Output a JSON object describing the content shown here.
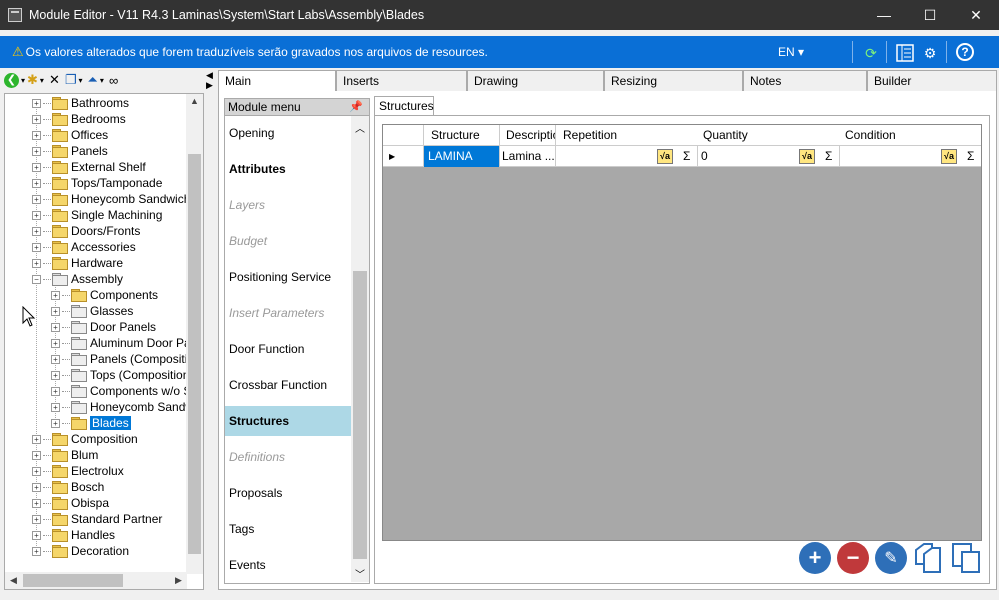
{
  "window": {
    "title": "Module Editor - V11 R4.3 Laminas\\System\\Start Labs\\Assembly\\Blades",
    "minimize": "—",
    "maximize": "☐",
    "close": "✕"
  },
  "notification": {
    "icon": "warning-icon",
    "message": "Os valores alterados que forem traduzíveis serão gravados nos arquivos de resources.",
    "language": "EN ▾",
    "refresh": "⟳",
    "help": "?"
  },
  "tree": {
    "items": [
      {
        "label": "Bathrooms"
      },
      {
        "label": "Bedrooms"
      },
      {
        "label": "Offices"
      },
      {
        "label": "Panels"
      },
      {
        "label": "External Shelf"
      },
      {
        "label": "Tops/Tamponade"
      },
      {
        "label": "Honeycomb Sandwich"
      },
      {
        "label": "Single Machining"
      },
      {
        "label": "Doors/Fronts"
      },
      {
        "label": "Accessories"
      },
      {
        "label": "Hardware"
      },
      {
        "label": "Assembly"
      },
      {
        "label": "Components"
      },
      {
        "label": "Glasses"
      },
      {
        "label": "Door Panels"
      },
      {
        "label": "Aluminum Door Pane"
      },
      {
        "label": "Panels (Composition"
      },
      {
        "label": "Tops (Composition)"
      },
      {
        "label": "Components w/o Str"
      },
      {
        "label": "Honeycomb Sandwic"
      },
      {
        "label": "Blades"
      },
      {
        "label": "Composition"
      },
      {
        "label": "Blum"
      },
      {
        "label": "Electrolux"
      },
      {
        "label": "Bosch"
      },
      {
        "label": "Obispa"
      },
      {
        "label": "Standard Partner"
      },
      {
        "label": "Handles"
      },
      {
        "label": "Decoration"
      }
    ]
  },
  "tabs": [
    "Main",
    "Inserts",
    "Drawing",
    "Resizing",
    "Notes",
    "Builder"
  ],
  "module_menu": {
    "header": "Module menu",
    "items": [
      {
        "label": "Opening"
      },
      {
        "label": "Attributes"
      },
      {
        "label": "Layers"
      },
      {
        "label": "Budget"
      },
      {
        "label": "Positioning Service"
      },
      {
        "label": "Insert Parameters"
      },
      {
        "label": "Door Function"
      },
      {
        "label": "Crossbar Function"
      },
      {
        "label": "Structures"
      },
      {
        "label": "Definitions"
      },
      {
        "label": "Proposals"
      },
      {
        "label": "Tags"
      },
      {
        "label": "Events"
      }
    ]
  },
  "structures": {
    "tab": "Structures",
    "columns": [
      "Structure",
      "Description",
      "Repetition",
      "Quantity",
      "Condition"
    ],
    "rows": [
      {
        "structure": "LAMINA",
        "description": "Lamina ...",
        "repetition": "",
        "quantity": "0",
        "condition": ""
      }
    ],
    "fx": "√a",
    "sigma": "Σ"
  }
}
